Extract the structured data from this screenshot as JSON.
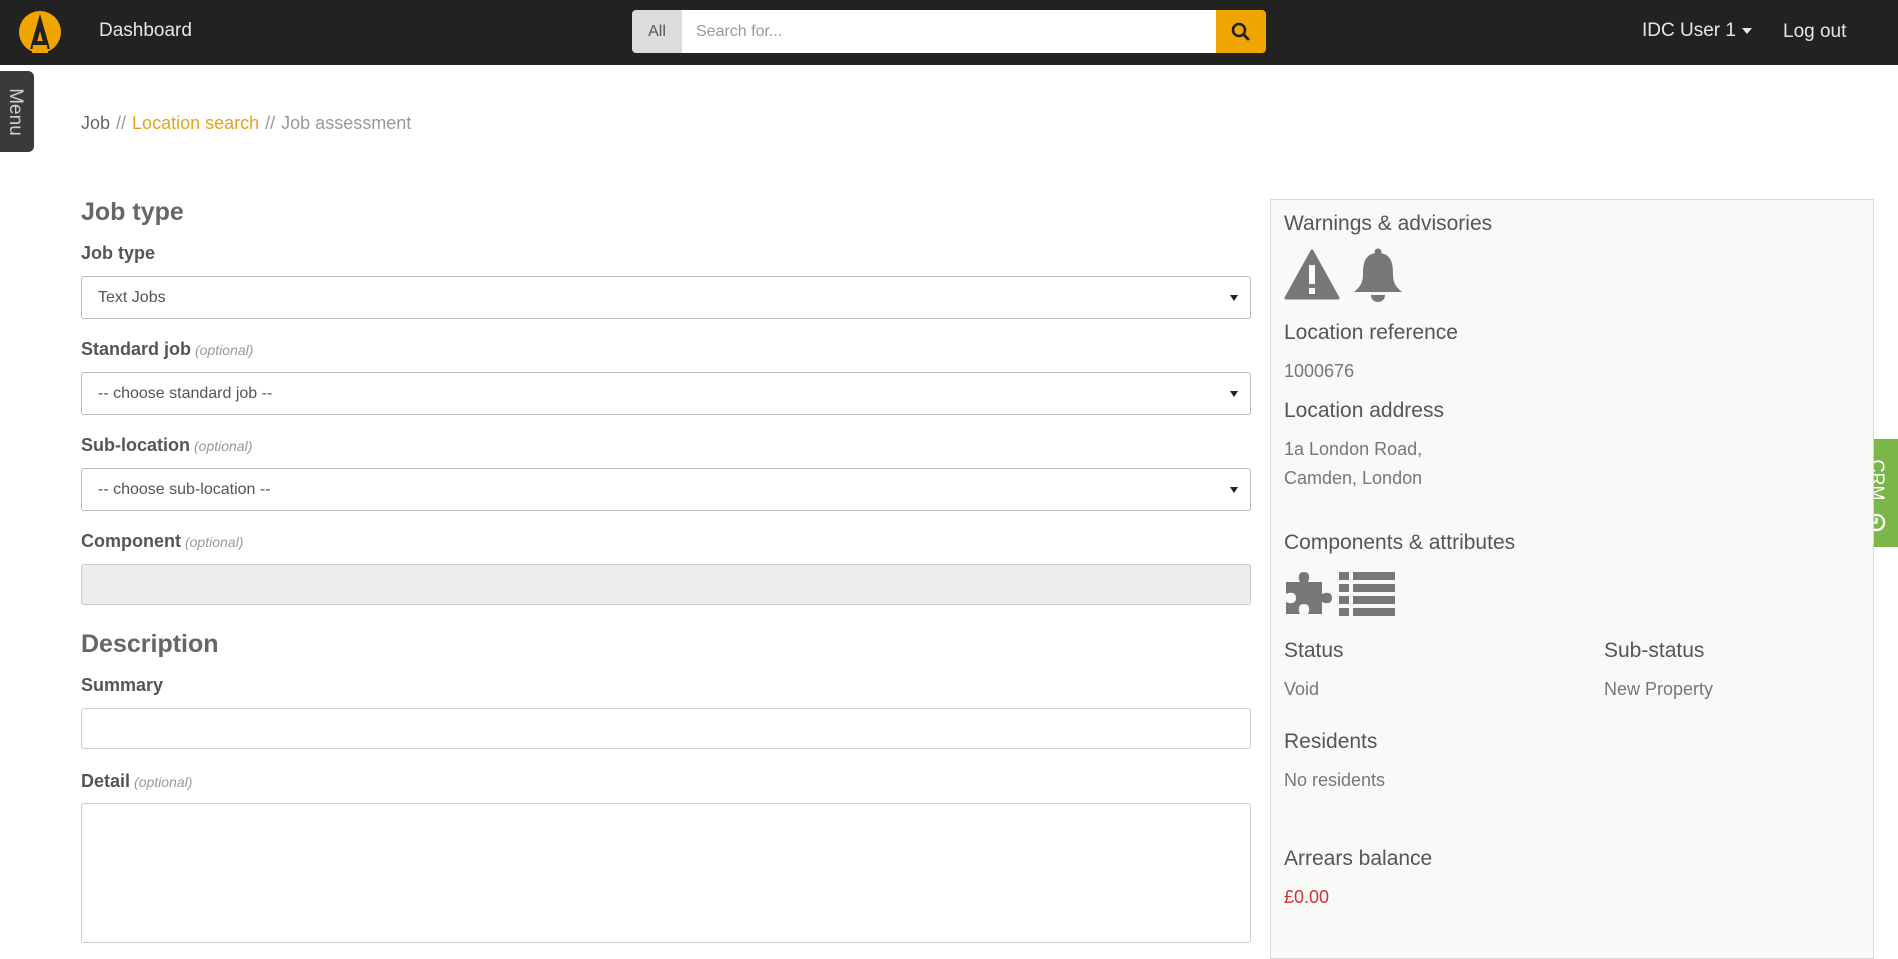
{
  "topbar": {
    "dashboard_label": "Dashboard",
    "search_scope": "All",
    "search_placeholder": "Search for...",
    "user_label": "IDC User 1",
    "logout_label": "Log out",
    "accent_color": "#f0a500"
  },
  "side_tabs": {
    "menu_label": "Menu",
    "crm_label": "CRM"
  },
  "breadcrumb": {
    "root": "Job",
    "separator": "//",
    "link": "Location search",
    "current": "Job assessment"
  },
  "form": {
    "job_type_section": "Job type",
    "job_type_label": "Job type",
    "job_type_value": "Text Jobs",
    "standard_job_label": "Standard job",
    "standard_job_value": "-- choose standard job --",
    "sub_location_label": "Sub-location",
    "sub_location_value": "-- choose sub-location --",
    "component_label": "Component",
    "optional_text": "(optional)",
    "description_section": "Description",
    "summary_label": "Summary",
    "detail_label": "Detail"
  },
  "panel": {
    "warnings_title": "Warnings & advisories",
    "warnings_icons": [
      "warning-icon",
      "bell-icon"
    ],
    "location_ref_label": "Location reference",
    "location_ref_value": "1000676",
    "location_address_label": "Location address",
    "address_line1": "1a London Road,",
    "address_line2": "Camden, London",
    "components_title": "Components & attributes",
    "components_icons": [
      "puzzle-icon",
      "list-icon"
    ],
    "status_label": "Status",
    "status_value": "Void",
    "substatus_label": "Sub-status",
    "substatus_value": "New Property",
    "residents_label": "Residents",
    "residents_value": "No residents",
    "arrears_label": "Arrears balance",
    "arrears_value": "£0.00",
    "arrears_color": "#d9302e"
  }
}
